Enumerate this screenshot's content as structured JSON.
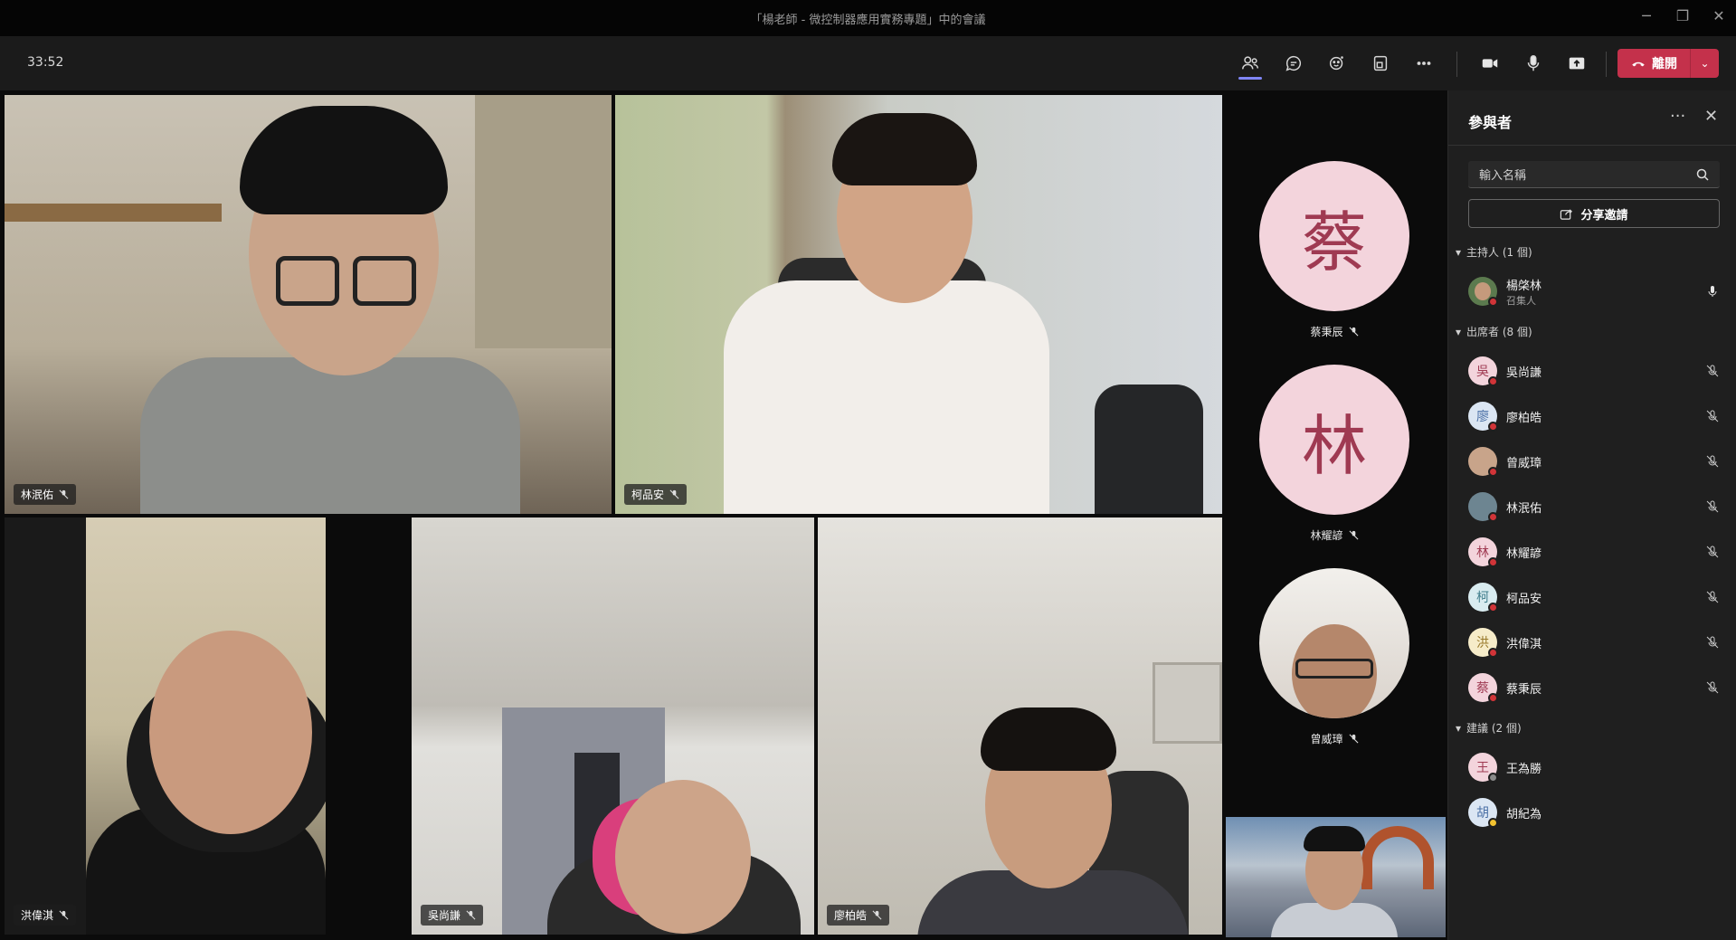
{
  "window": {
    "title": "「楊老師 - 微控制器應用實務專題」中的會議"
  },
  "toolbar": {
    "timer": "33:52",
    "leave_label": "離開",
    "icons": [
      "people-icon",
      "chat-icon",
      "reactions-icon",
      "view-icon",
      "more-icon",
      "camera-icon",
      "mic-icon",
      "share-icon"
    ]
  },
  "tiles": [
    {
      "name": "林泯佑"
    },
    {
      "name": "柯品安"
    },
    {
      "name": "洪偉淇"
    },
    {
      "name": "吳尚謙"
    },
    {
      "name": "廖柏皓"
    }
  ],
  "avatars": [
    {
      "initial": "蔡",
      "name": "蔡秉辰"
    },
    {
      "initial": "林",
      "name": "林耀諺"
    },
    {
      "initial": "",
      "name": "曾威璋"
    }
  ],
  "panel": {
    "title": "參與者",
    "search_placeholder": "輸入名稱",
    "invite_label": "分享邀請",
    "organizer_section": "主持人 (1 個)",
    "attendee_section": "出席者 (8 個)",
    "suggest_section": "建議 (2 個)",
    "organizer": {
      "name": "楊棨林",
      "role": "召集人"
    },
    "attendees": [
      {
        "initial": "吳",
        "name": "吳尚謙"
      },
      {
        "initial": "廖",
        "name": "廖柏皓"
      },
      {
        "initial": "",
        "name": "曾威璋"
      },
      {
        "initial": "",
        "name": "林泯佑"
      },
      {
        "initial": "林",
        "name": "林耀諺"
      },
      {
        "initial": "柯",
        "name": "柯品安"
      },
      {
        "initial": "洪",
        "name": "洪偉淇"
      },
      {
        "initial": "蔡",
        "name": "蔡秉辰"
      }
    ],
    "suggested": [
      {
        "initial": "王",
        "name": "王為勝"
      },
      {
        "initial": "胡",
        "name": "胡紀為"
      }
    ]
  },
  "colors": {
    "accent": "#7f85f5",
    "leave": "#c4314b",
    "avatar_bg": "#f3d4dc",
    "avatar_fg": "#9f3a52"
  }
}
